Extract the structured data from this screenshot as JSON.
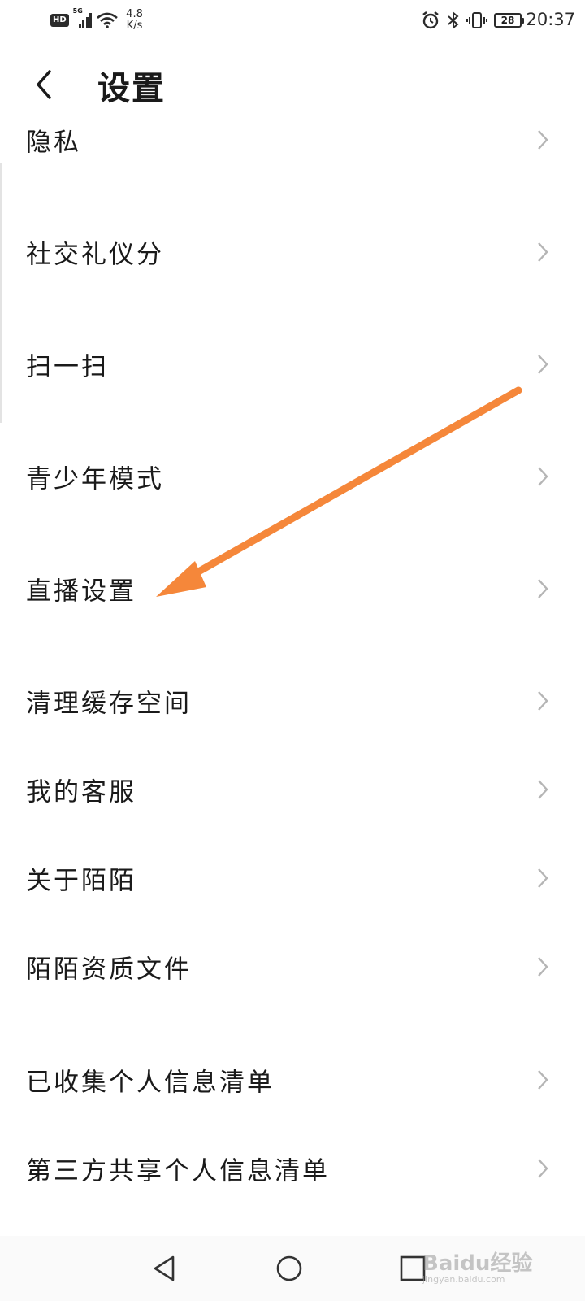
{
  "status_bar": {
    "hd": "HD",
    "network": "5G",
    "speed_value": "4.8",
    "speed_unit": "K/s",
    "battery": "28",
    "time": "20:37"
  },
  "header": {
    "title": "设置"
  },
  "settings": [
    {
      "label": "隐私"
    },
    {
      "label": "社交礼仪分"
    },
    {
      "label": "扫一扫"
    },
    {
      "label": "青少年模式"
    },
    {
      "label": "直播设置"
    },
    {
      "label": "清理缓存空间"
    },
    {
      "label": "我的客服"
    },
    {
      "label": "关于陌陌"
    },
    {
      "label": "陌陌资质文件"
    },
    {
      "label": "已收集个人信息清单"
    },
    {
      "label": "第三方共享个人信息清单"
    }
  ],
  "annotation": {
    "arrow_color": "#F5873A",
    "points_to": "直播设置"
  },
  "watermark": {
    "text": "Baidu经验",
    "sub": "jingyan.baidu.com"
  }
}
